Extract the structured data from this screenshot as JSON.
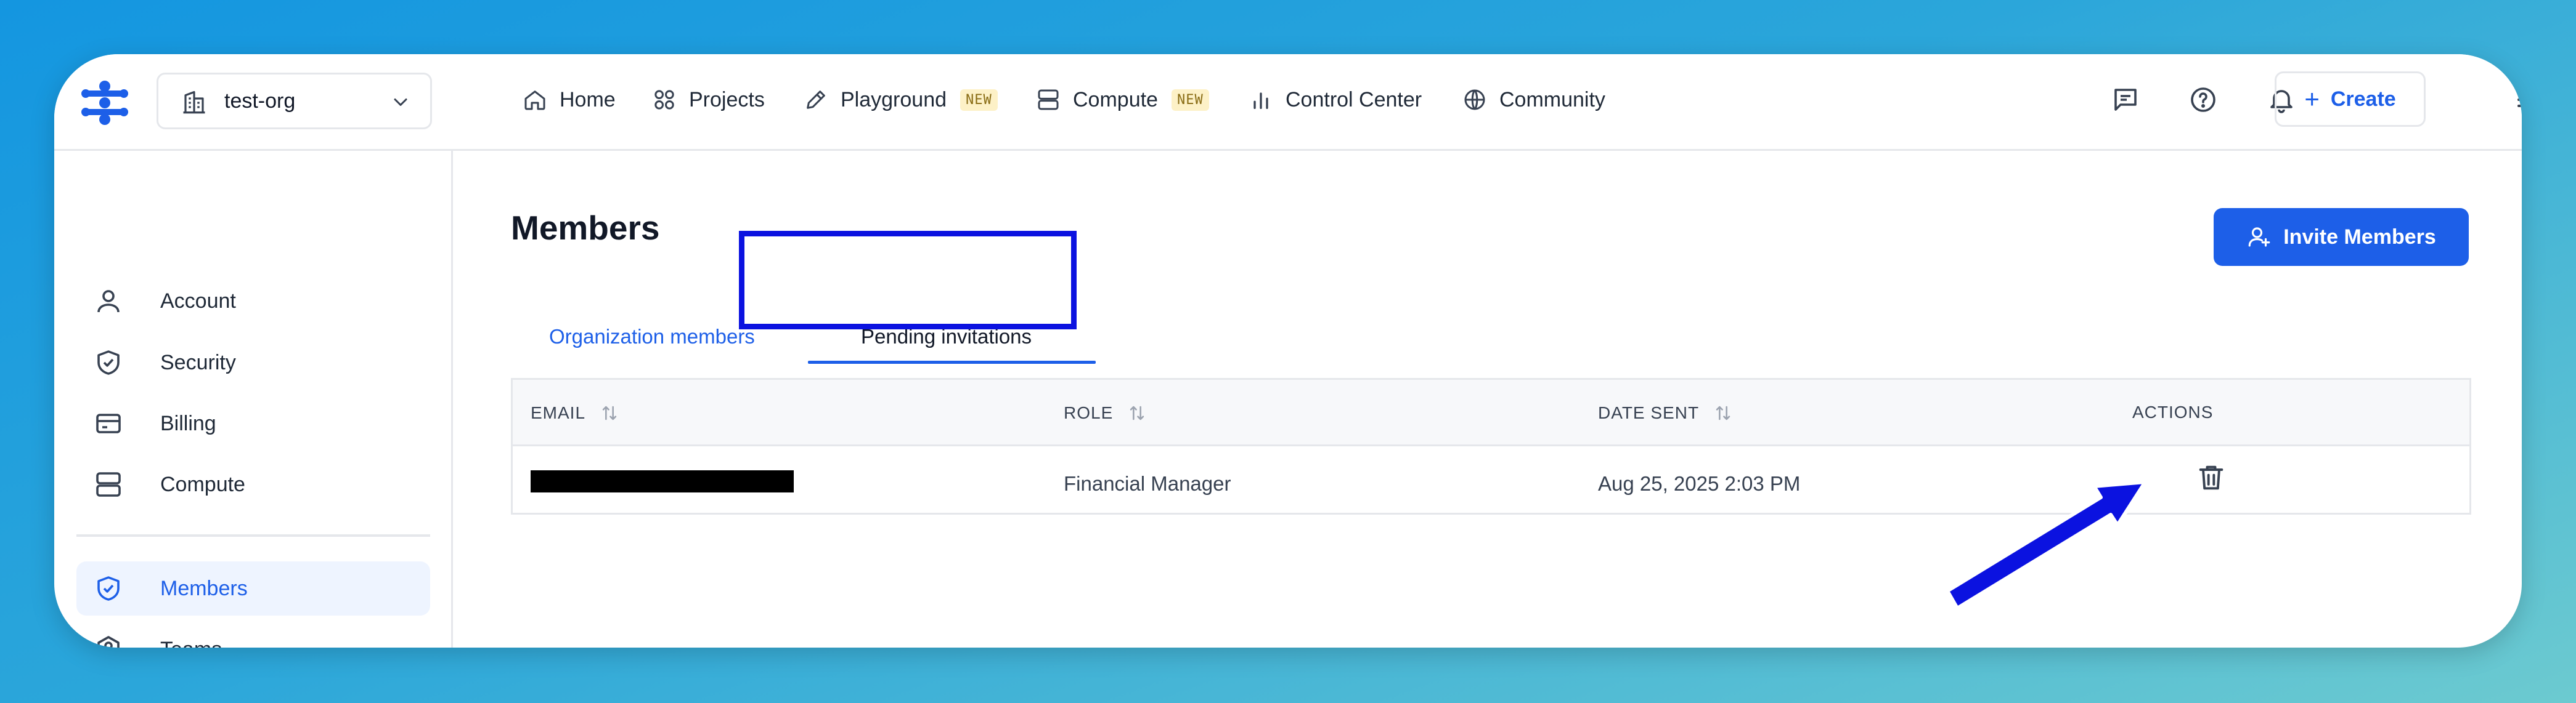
{
  "org_selector": {
    "value": "test-org"
  },
  "nav": [
    {
      "label": "Home",
      "badge": ""
    },
    {
      "label": "Projects",
      "badge": ""
    },
    {
      "label": "Playground",
      "badge": "NEW"
    },
    {
      "label": "Compute",
      "badge": "NEW"
    },
    {
      "label": "Control Center",
      "badge": ""
    },
    {
      "label": "Community",
      "badge": ""
    }
  ],
  "header_actions": {
    "icons": [
      "feedback-icon",
      "help-icon",
      "notifications-icon",
      "menu-icon"
    ],
    "create_label": "Create"
  },
  "sidebar": {
    "items": [
      {
        "label": "Account",
        "icon": "user-icon"
      },
      {
        "label": "Security",
        "icon": "shield-check-icon"
      },
      {
        "label": "Billing",
        "icon": "credit-card-icon"
      },
      {
        "label": "Compute",
        "icon": "server-icon"
      },
      {
        "label": "Members",
        "icon": "shield-check-icon",
        "active": true
      },
      {
        "label": "Teams",
        "icon": "teams-icon"
      }
    ]
  },
  "main": {
    "title": "Members",
    "invite_button": "Invite Members",
    "tabs": [
      {
        "label": "Organization members",
        "active": false
      },
      {
        "label": "Pending invitations",
        "active": true
      }
    ],
    "table": {
      "columns": [
        "EMAIL",
        "ROLE",
        "DATE SENT",
        "ACTIONS"
      ],
      "rows": [
        {
          "email": "",
          "role": "Financial Manager",
          "date_sent": "Aug 25, 2025 2:03 PM",
          "action": "trash-icon"
        }
      ]
    }
  },
  "colors": {
    "accent": "#1d5fe8",
    "annotation": "#0b12e0",
    "badge_bg": "#fdf1c7",
    "active_bg": "#eef4ff"
  }
}
